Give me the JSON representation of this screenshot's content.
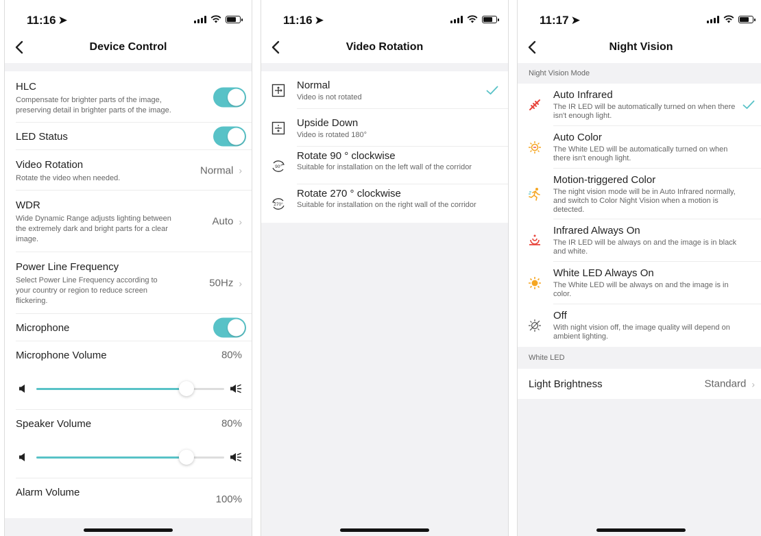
{
  "screens": {
    "device_control": {
      "status": {
        "time": "11:16"
      },
      "title": "Device Control",
      "hlc": {
        "title": "HLC",
        "desc": "Compensate for brighter parts of the image, preserving detail in brighter parts of the image.",
        "on": true
      },
      "led_status": {
        "title": "LED Status",
        "on": true
      },
      "video_rotation": {
        "title": "Video Rotation",
        "desc": "Rotate the video when needed.",
        "value": "Normal"
      },
      "wdr": {
        "title": "WDR",
        "desc": "Wide Dynamic Range adjusts lighting between the extremely dark and bright parts for a clear image.",
        "value": "Auto"
      },
      "power_line": {
        "title": "Power Line Frequency",
        "desc": "Select Power Line Frequency according to your country or region to reduce screen flickering.",
        "value": "50Hz"
      },
      "microphone": {
        "title": "Microphone",
        "on": true
      },
      "mic_volume": {
        "title": "Microphone Volume",
        "value": "80%",
        "level": 0.8
      },
      "speaker_volume": {
        "title": "Speaker Volume",
        "value": "80%",
        "level": 0.8
      },
      "alarm_volume": {
        "title": "Alarm Volume",
        "value": "100%"
      }
    },
    "video_rotation": {
      "status": {
        "time": "11:16"
      },
      "title": "Video Rotation",
      "options": [
        {
          "title": "Normal",
          "desc": "Video is not rotated",
          "icon": "normal-rotation-icon",
          "selected": true
        },
        {
          "title": "Upside Down",
          "desc": "Video is rotated 180°",
          "icon": "upside-down-icon",
          "selected": false
        },
        {
          "title": "Rotate 90 ° clockwise",
          "desc": "Suitable for installation on the left wall of the corridor",
          "icon": "rotate-90-icon",
          "icon_text": "90°",
          "selected": false
        },
        {
          "title": "Rotate 270 ° clockwise",
          "desc": "Suitable for installation on the right wall of the corridor",
          "icon": "rotate-270-icon",
          "icon_text": "270°",
          "selected": false
        }
      ]
    },
    "night_vision": {
      "status": {
        "time": "11:17"
      },
      "title": "Night Vision",
      "mode_section": "Night Vision Mode",
      "modes": [
        {
          "title": "Auto Infrared",
          "desc": "The IR LED will be automatically turned on when there isn't enough light.",
          "icon": "auto-infrared-icon",
          "selected": true
        },
        {
          "title": "Auto Color",
          "desc": "The White LED will be automatically turned on when there isn't enough light.",
          "icon": "auto-color-icon",
          "selected": false
        },
        {
          "title": "Motion-triggered Color",
          "desc": "The night vision mode will be in Auto Infrared normally, and switch to Color Night Vision when a motion is detected.",
          "icon": "motion-color-icon",
          "selected": false
        },
        {
          "title": "Infrared Always On",
          "desc": "The IR LED will be always on and the image is in black and white.",
          "icon": "infrared-on-icon",
          "selected": false
        },
        {
          "title": "White LED Always On",
          "desc": "The White LED will be always on and the image is in color.",
          "icon": "white-led-icon",
          "selected": false
        },
        {
          "title": "Off",
          "desc": "With night vision off, the image quality will depend on ambient lighting.",
          "icon": "night-vision-off-icon",
          "selected": false
        }
      ],
      "led_section": "White LED",
      "brightness": {
        "title": "Light Brightness",
        "value": "Standard"
      }
    }
  },
  "colors": {
    "accent": "#58c2c7",
    "background": "#f2f2f4",
    "ir_red": "#e8453c",
    "color_orange": "#f5a623"
  }
}
